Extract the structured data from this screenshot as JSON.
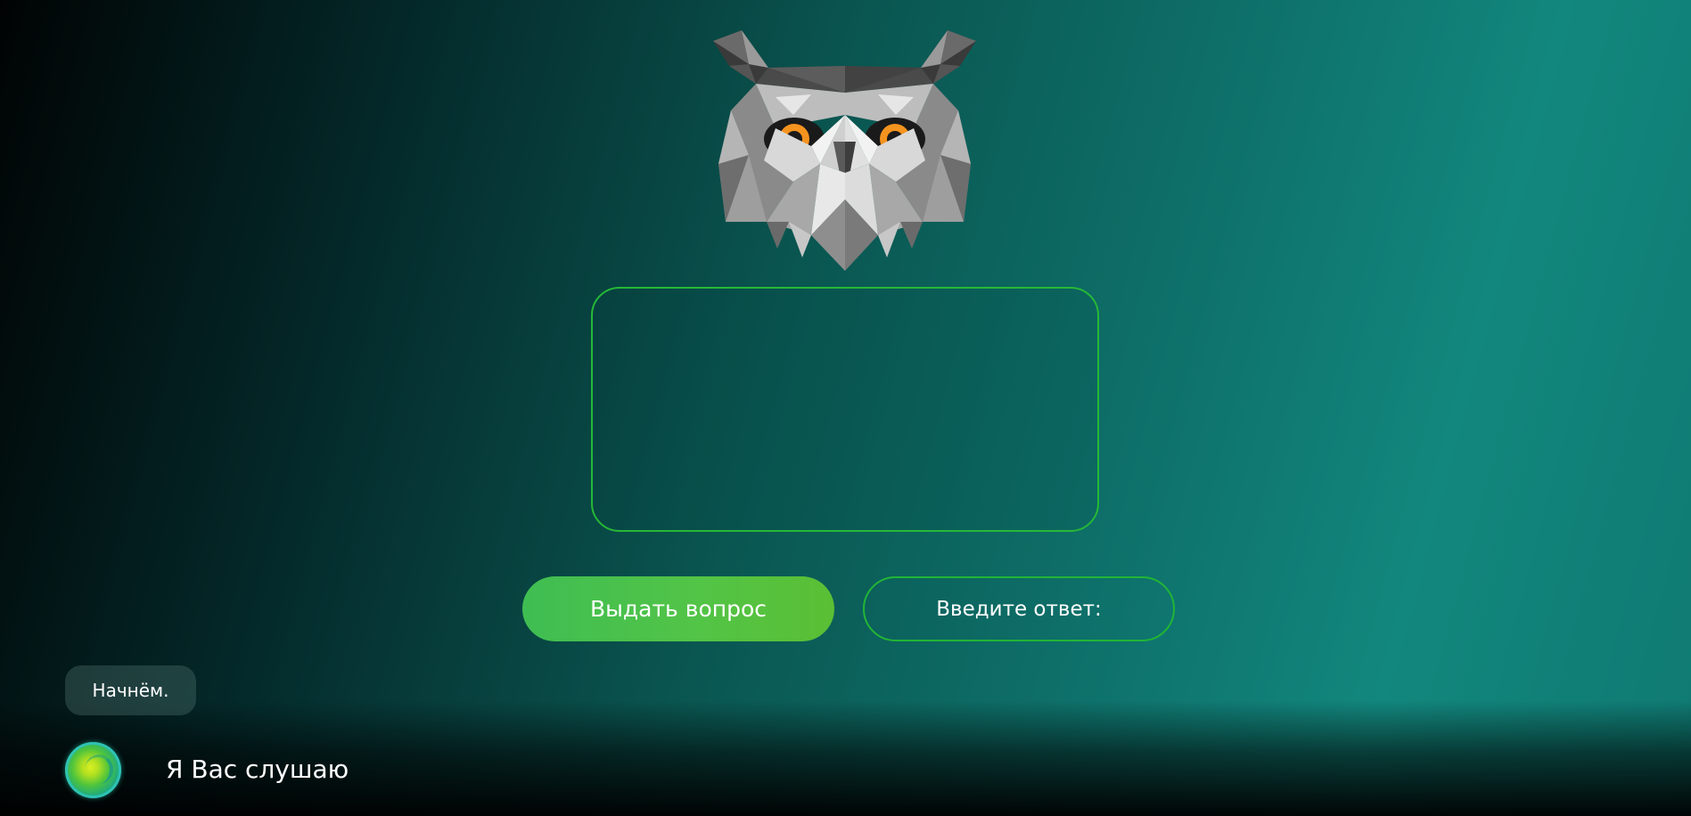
{
  "owl": {
    "icon": "owl-logo-icon",
    "eye_color": "#f5931f"
  },
  "question_box": {
    "text": ""
  },
  "buttons": {
    "get_question_label": "Выдать вопрос",
    "answer_label": "Введите ответ:"
  },
  "chat": {
    "bubble_text": "Начнём."
  },
  "assistant": {
    "icon": "assistant-orb-icon",
    "status_text": "Я Вас слушаю"
  },
  "colors": {
    "accent_green": "#26b836",
    "button_fill": "#4fc247"
  }
}
